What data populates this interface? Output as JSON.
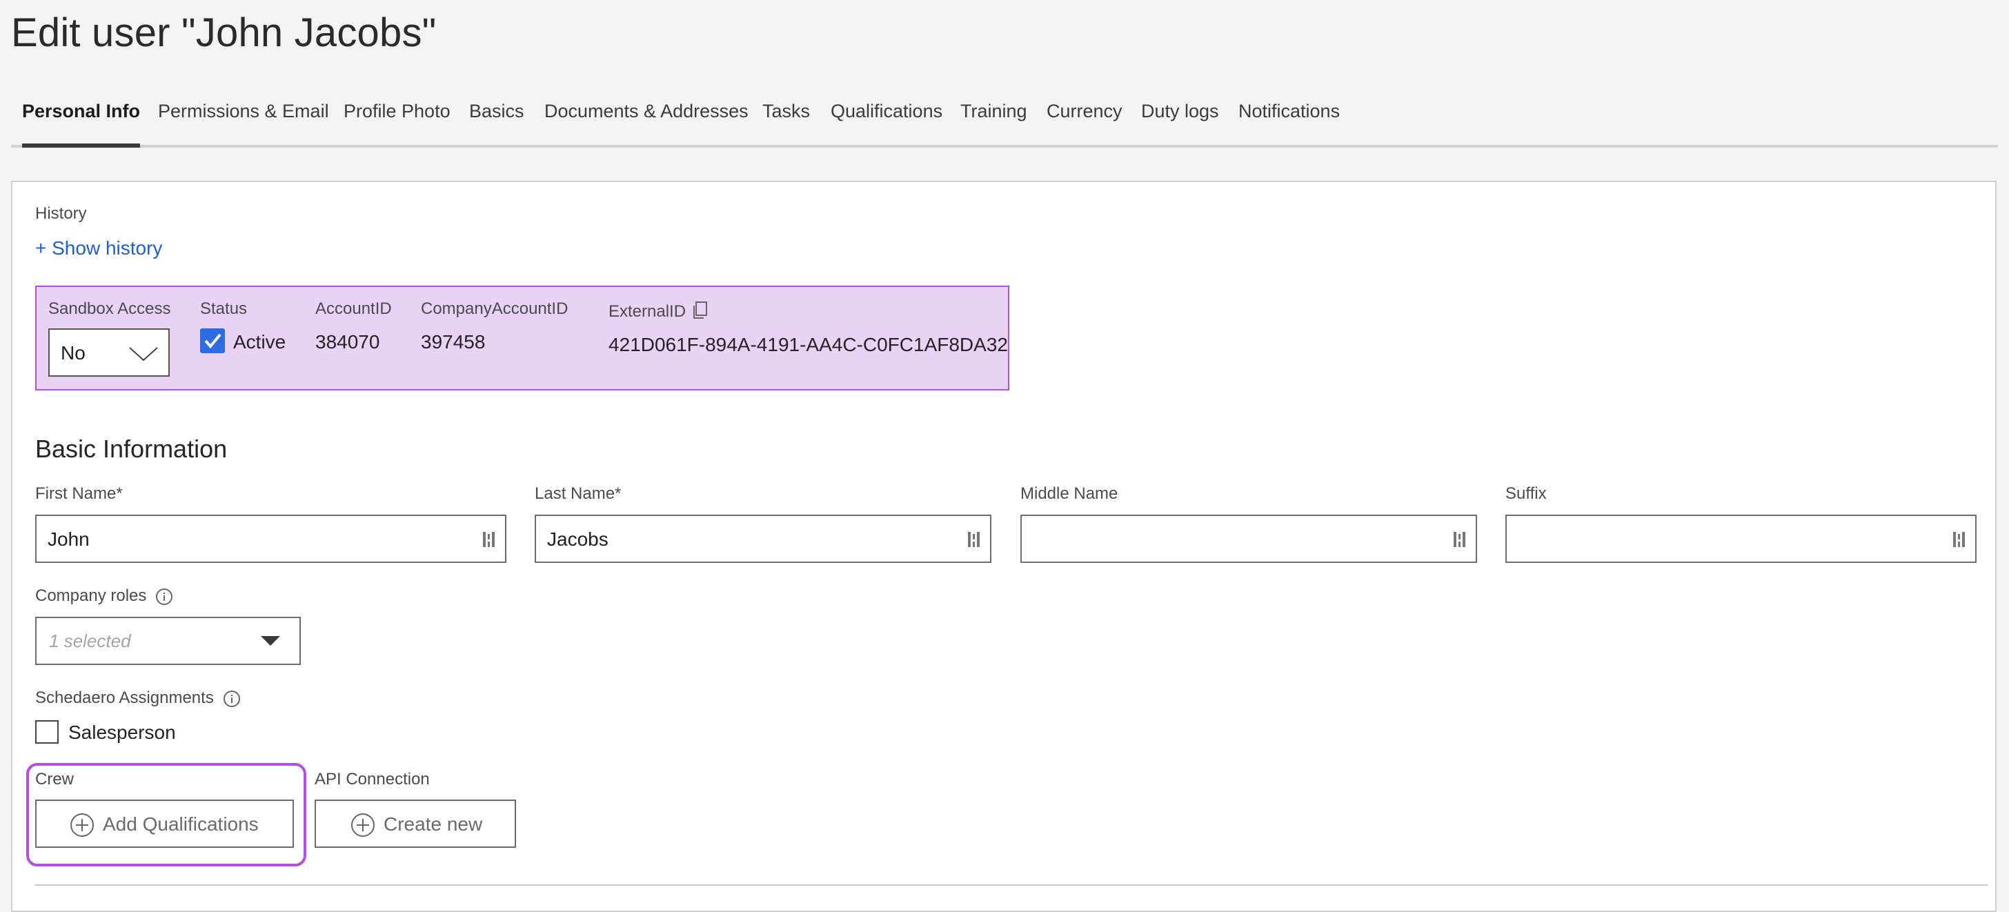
{
  "page": {
    "title": "Edit user \"John Jacobs\""
  },
  "tabs": [
    {
      "label": "Personal Info",
      "active": true
    },
    {
      "label": "Permissions & Email"
    },
    {
      "label": "Profile Photo"
    },
    {
      "label": "Basics"
    },
    {
      "label": "Documents & Addresses"
    },
    {
      "label": "Tasks"
    },
    {
      "label": "Qualifications"
    },
    {
      "label": "Training"
    },
    {
      "label": "Currency"
    },
    {
      "label": "Duty logs"
    },
    {
      "label": "Notifications"
    }
  ],
  "history": {
    "label": "History",
    "show_link": "+ Show history"
  },
  "meta": {
    "sandbox_label": "Sandbox Access",
    "sandbox_value": "No",
    "status_label": "Status",
    "status_value": "Active",
    "status_checked": true,
    "account_id_label": "AccountID",
    "account_id_value": "384070",
    "company_account_id_label": "CompanyAccountID",
    "company_account_id_value": "397458",
    "external_id_label": "ExternalID",
    "external_id_value": "421D061F-894A-4191-AA4C-C0FC1AF8DA32",
    "highlight_color": "#b74ee6",
    "background_color": "#e9d3f5"
  },
  "basic_info": {
    "title": "Basic Information",
    "first_name_label": "First Name*",
    "first_name_value": "John",
    "last_name_label": "Last Name*",
    "last_name_value": "Jacobs",
    "middle_name_label": "Middle Name",
    "middle_name_value": "",
    "suffix_label": "Suffix",
    "suffix_value": ""
  },
  "company_roles": {
    "label": "Company roles",
    "placeholder": "1 selected"
  },
  "schedaero": {
    "label": "Schedaero Assignments",
    "salesperson_label": "Salesperson",
    "salesperson_checked": false
  },
  "crew": {
    "label": "Crew",
    "button": "Add Qualifications"
  },
  "api": {
    "label": "API Connection",
    "button": "Create new"
  },
  "colors": {
    "accent_link": "#1c5fcf",
    "checkbox_blue": "#2d6ce5"
  }
}
